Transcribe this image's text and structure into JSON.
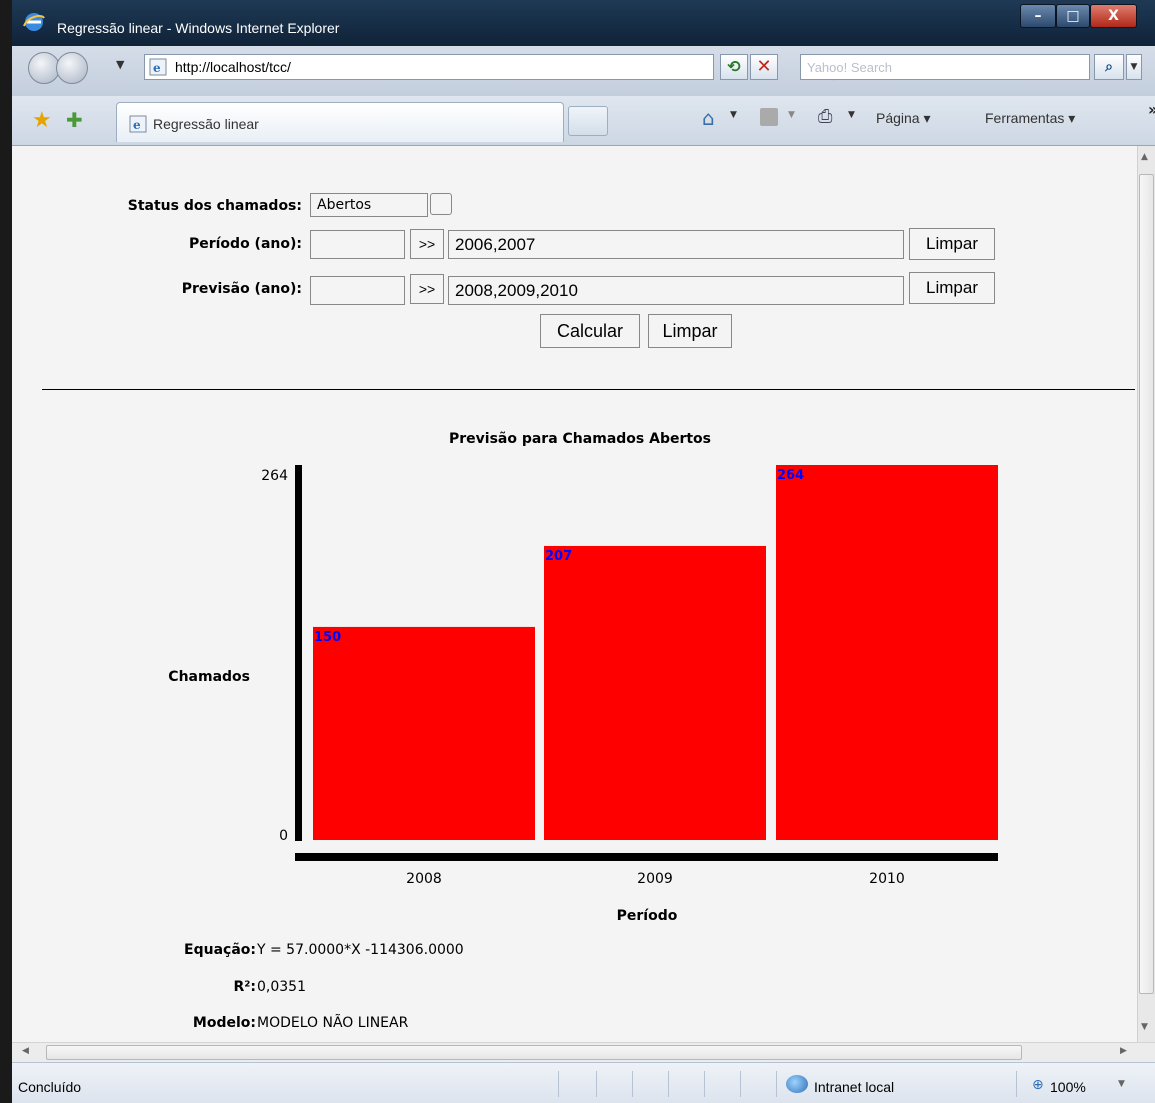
{
  "window": {
    "title": "Regressão linear - Windows Internet Explorer",
    "minimize": "–",
    "maximize": "□",
    "close": "X"
  },
  "nav": {
    "address": "http://localhost/tcc/",
    "search_placeholder": "Yahoo! Search"
  },
  "tabs": {
    "active_label": "Regressão linear"
  },
  "commands": {
    "page": "Página ▾",
    "tools": "Ferramentas ▾"
  },
  "form": {
    "status_label": "Status dos chamados:",
    "status_value": "Abertos",
    "periodo_label": "Período (ano):",
    "periodo_input": "",
    "periodo_add": ">>",
    "periodo_list": "2006,2007",
    "periodo_clear": "Limpar",
    "previsao_label": "Previsão (ano):",
    "previsao_input": "",
    "previsao_add": ">>",
    "previsao_list": "2008,2009,2010",
    "previsao_clear": "Limpar",
    "calcular": "Calcular",
    "limpar": "Limpar"
  },
  "chart_data": {
    "type": "bar",
    "title": "Previsão para Chamados Abertos",
    "xlabel": "Período",
    "ylabel": "Chamados",
    "categories": [
      "2008",
      "2009",
      "2010"
    ],
    "values": [
      150,
      207,
      264
    ],
    "ylim": [
      0,
      264
    ],
    "ytick_labels": [
      "264",
      "0"
    ],
    "data_labels": [
      "150",
      "207",
      "264"
    ],
    "bar_color": "#ff0000",
    "label_color": "#0000ff",
    "grid": false
  },
  "results": {
    "equacao_label": "Equação:",
    "equacao_value": "Y = 57.0000*X -114306.0000",
    "r2_label": "R²:",
    "r2_value": "0,0351",
    "modelo_label": "Modelo:",
    "modelo_value": "MODELO NÃO LINEAR"
  },
  "status": {
    "text": "Concluído",
    "zone": "Intranet local",
    "zoom": "100%"
  }
}
